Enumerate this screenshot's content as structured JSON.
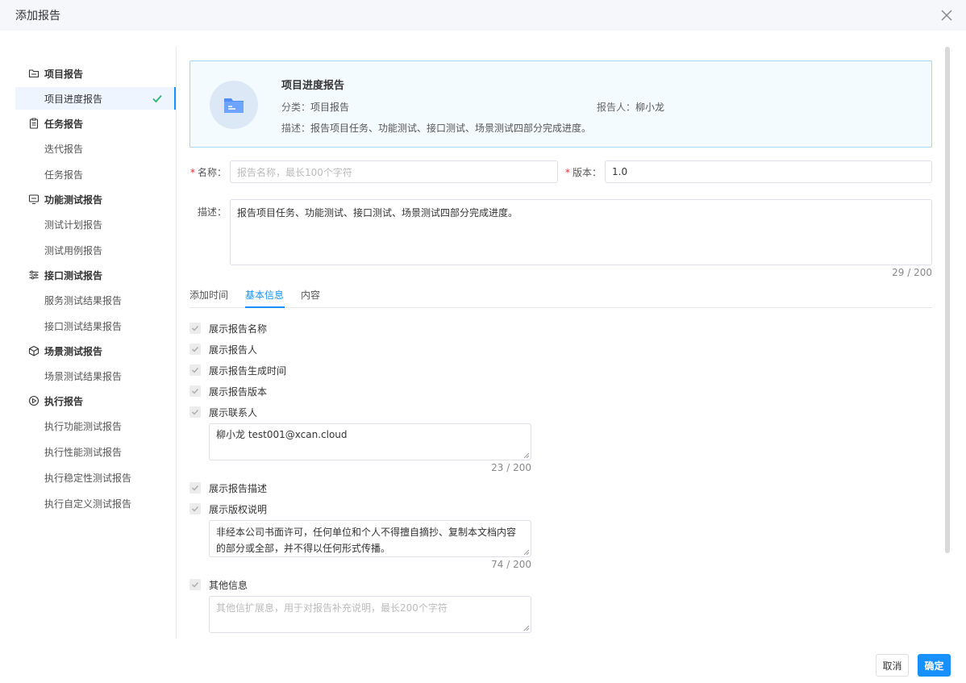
{
  "dialog": {
    "title": "添加报告"
  },
  "sidebar": {
    "groups": [
      {
        "label": "项目报告",
        "icon": "folder-icon",
        "items": [
          "项目进度报告"
        ]
      },
      {
        "label": "任务报告",
        "icon": "clipboard-icon",
        "items": [
          "迭代报告",
          "任务报告"
        ]
      },
      {
        "label": "功能测试报告",
        "icon": "monitor-icon",
        "items": [
          "测试计划报告",
          "测试用例报告"
        ]
      },
      {
        "label": "接口测试报告",
        "icon": "sliders-icon",
        "items": [
          "服务测试结果报告",
          "接口测试结果报告"
        ]
      },
      {
        "label": "场景测试报告",
        "icon": "cube-icon",
        "items": [
          "场景测试结果报告"
        ]
      },
      {
        "label": "执行报告",
        "icon": "gear-play-icon",
        "items": [
          "执行功能测试报告",
          "执行性能测试报告",
          "执行稳定性测试报告",
          "执行自定义测试报告"
        ]
      }
    ],
    "selected": "项目进度报告"
  },
  "card": {
    "title": "项目进度报告",
    "category_label": "分类：",
    "category": "项目报告",
    "reporter_label": "报告人：",
    "reporter": "柳小龙",
    "desc_label": "描述：",
    "desc": "报告项目任务、功能测试、接口测试、场景测试四部分完成进度。"
  },
  "form": {
    "name_label": "名称：",
    "name_placeholder": "报告名称，最长100个字符",
    "version_label": "版本：",
    "version_value": "1.0",
    "desc_label": "描述：",
    "desc_value": "报告项目任务、功能测试、接口测试、场景测试四部分完成进度。",
    "desc_counter": "29 / 200"
  },
  "tabs": [
    {
      "label": "添加时间",
      "active": false
    },
    {
      "label": "基本信息",
      "active": true
    },
    {
      "label": "内容",
      "active": false
    }
  ],
  "basic_info": {
    "show_name": "展示报告名称",
    "show_reporter": "展示报告人",
    "show_time": "展示报告生成时间",
    "show_version": "展示报告版本",
    "show_contact": "展示联系人",
    "contact_value": "柳小龙  test001@xcan.cloud",
    "contact_counter": "23 / 200",
    "show_desc": "展示报告描述",
    "show_copyright": "展示版权说明",
    "copyright_value": "非经本公司书面许可，任何单位和个人不得擅自摘抄、复制本文档内容的部分或全部，并不得以任何形式传播。",
    "copyright_counter": "74 / 200",
    "other_label": "其他信息",
    "other_placeholder": "其他信扩展息，用于对报告补充说明，最长200个字符"
  },
  "footer": {
    "cancel": "取消",
    "ok": "确定"
  },
  "colors": {
    "primary": "#1890ff",
    "required": "#f5222d",
    "check": "#2bb673"
  }
}
